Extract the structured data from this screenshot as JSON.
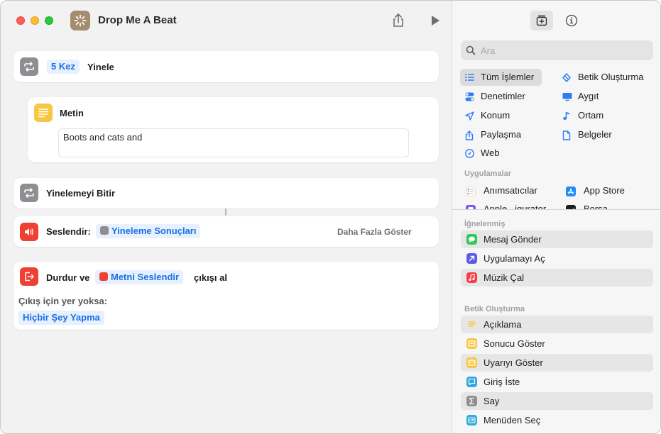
{
  "window": {
    "title": "Drop Me A Beat"
  },
  "toolbar": {
    "share_icon": "share-icon",
    "run_icon": "play-icon"
  },
  "actions": {
    "repeat": {
      "count_token": "5 Kez",
      "label": "Yinele"
    },
    "text": {
      "title": "Metin",
      "value": "Boots and cats and"
    },
    "end_repeat": {
      "label": "Yinelemeyi Bitir"
    },
    "speak": {
      "label": "Seslendir:",
      "token": "Yineleme Sonuçları",
      "more": "Daha Fazla Göster"
    },
    "stop": {
      "label_before": "Durdur ve",
      "token": "Metni Seslendir",
      "label_after": "çıkışı al",
      "no_output_label": "Çıkış için yer yoksa:",
      "no_output_token": "Hiçbir Şey Yapma"
    }
  },
  "library": {
    "search_placeholder": "Ara",
    "categories": [
      {
        "label": "Tüm İşlemler",
        "icon": "list-icon",
        "selected": true
      },
      {
        "label": "Betik Oluşturma",
        "icon": "scripting-icon"
      },
      {
        "label": "Denetimler",
        "icon": "toggle-icon"
      },
      {
        "label": "Aygıt",
        "icon": "display-icon"
      },
      {
        "label": "Konum",
        "icon": "location-icon"
      },
      {
        "label": "Ortam",
        "icon": "music-note-icon"
      },
      {
        "label": "Paylaşma",
        "icon": "share-icon"
      },
      {
        "label": "Belgeler",
        "icon": "document-icon"
      },
      {
        "label": "Web",
        "icon": "compass-icon"
      }
    ],
    "apps_header": "Uygulamalar",
    "apps": [
      {
        "label": "Anımsatıcılar",
        "icon": "reminders-icon"
      },
      {
        "label": "App Store",
        "icon": "app-store-icon"
      },
      {
        "label": "Apple...igurator",
        "icon": "configurator-icon"
      },
      {
        "label": "Borsa",
        "icon": "stocks-icon"
      }
    ],
    "pinned_header": "İğnelenmiş",
    "pinned": [
      {
        "label": "Mesaj Gönder",
        "icon": "messages-icon",
        "color": "#34c759"
      },
      {
        "label": "Uygulamayı Aç",
        "icon": "open-app-icon",
        "color": "#5e5ce6"
      },
      {
        "label": "Müzik Çal",
        "icon": "music-icon",
        "color": "#fc3c44"
      }
    ],
    "scripting_header": "Betik Oluşturma",
    "scripting": [
      {
        "label": "Açıklama",
        "icon": "comment-icon",
        "color": "#f7c744"
      },
      {
        "label": "Sonucu Göster",
        "icon": "show-result-icon",
        "color": "#f7c744"
      },
      {
        "label": "Uyarıyı Göster",
        "icon": "alert-icon",
        "color": "#f7c744"
      },
      {
        "label": "Giriş İste",
        "icon": "ask-input-icon",
        "color": "#34aadc"
      },
      {
        "label": "Say",
        "icon": "count-icon",
        "color": "#8e8e93"
      },
      {
        "label": "Menüden Seç",
        "icon": "menu-icon",
        "color": "#34aadc"
      }
    ]
  }
}
